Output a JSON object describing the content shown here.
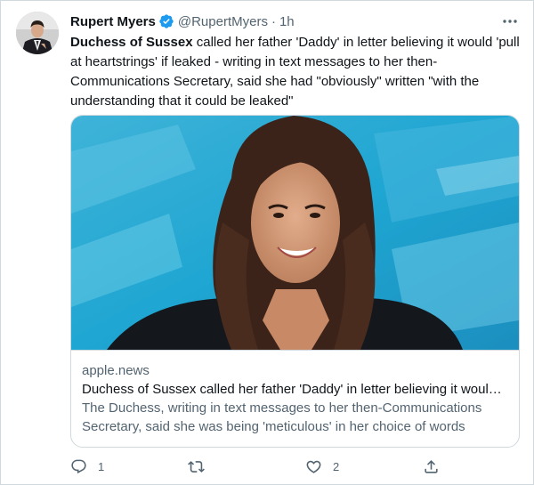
{
  "author": {
    "name": "Rupert Myers",
    "handle": "@RupertMyers",
    "separator": "·",
    "time": "1h",
    "avatar_icon": "profile-photo-icon",
    "verified_icon": "verified-badge-icon"
  },
  "tweet": {
    "bold_lead": "Duchess of Sussex",
    "text_rest": " called her father 'Daddy' in letter believing it would 'pull at heartstrings' if leaked - writing in text messages to her then-Communications Secretary, said she had \"obviously\" written \"with the understanding that it could be leaked\""
  },
  "card": {
    "domain": "apple.news",
    "title": "Duchess of Sussex called her father 'Daddy' in letter believing it would 'pull at heartstrings' if leaked",
    "description": "The Duchess, writing in text messages to her then-Communications Secretary, said she was being 'meticulous' in her choice of words",
    "image_icon": "article-photo-icon"
  },
  "actions": {
    "reply_count": "1",
    "retweet_count": "",
    "like_count": "2"
  },
  "colors": {
    "verified": "#1d9bf0",
    "secondary_text": "#536471",
    "primary_text": "#0f1419",
    "border": "#cfd9de",
    "photo_background": "#27a8d0"
  }
}
